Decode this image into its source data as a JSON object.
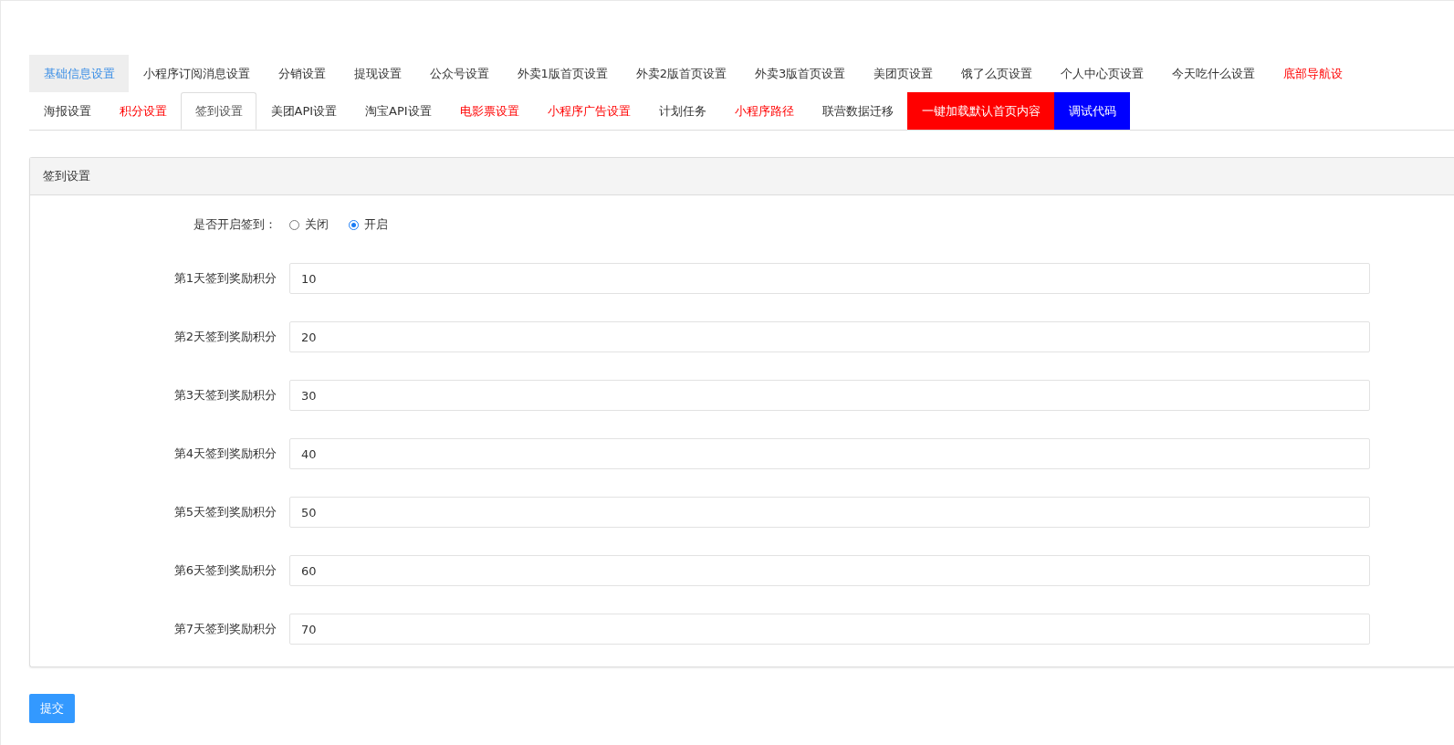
{
  "tab_rows": [
    [
      {
        "label": "基础信息设置",
        "kind": "highlight",
        "selected": false
      },
      {
        "label": "小程序订阅消息设置",
        "kind": "plain",
        "selected": false
      },
      {
        "label": "分销设置",
        "kind": "plain",
        "selected": false
      },
      {
        "label": "提现设置",
        "kind": "plain",
        "selected": false
      },
      {
        "label": "公众号设置",
        "kind": "plain",
        "selected": false
      },
      {
        "label": "外卖1版首页设置",
        "kind": "plain",
        "selected": false
      },
      {
        "label": "外卖2版首页设置",
        "kind": "plain",
        "selected": false
      },
      {
        "label": "外卖3版首页设置",
        "kind": "plain",
        "selected": false
      },
      {
        "label": "美团页设置",
        "kind": "plain",
        "selected": false
      },
      {
        "label": "饿了么页设置",
        "kind": "plain",
        "selected": false
      },
      {
        "label": "个人中心页设置",
        "kind": "plain",
        "selected": false
      },
      {
        "label": "今天吃什么设置",
        "kind": "plain",
        "selected": false
      },
      {
        "label": "底部导航设",
        "kind": "red",
        "selected": false
      }
    ],
    [
      {
        "label": "海报设置",
        "kind": "plain",
        "selected": false
      },
      {
        "label": "积分设置",
        "kind": "red",
        "selected": false
      },
      {
        "label": "签到设置",
        "kind": "plain",
        "selected": true
      },
      {
        "label": "美团API设置",
        "kind": "plain",
        "selected": false
      },
      {
        "label": "淘宝API设置",
        "kind": "plain",
        "selected": false
      },
      {
        "label": "电影票设置",
        "kind": "red",
        "selected": false
      },
      {
        "label": "小程序广告设置",
        "kind": "red",
        "selected": false
      },
      {
        "label": "计划任务",
        "kind": "plain",
        "selected": false
      },
      {
        "label": "小程序路径",
        "kind": "red",
        "selected": false
      },
      {
        "label": "联营数据迁移",
        "kind": "plain",
        "selected": false
      },
      {
        "label": "一键加载默认首页内容",
        "kind": "red-block",
        "selected": false
      },
      {
        "label": "调试代码",
        "kind": "blue-block",
        "selected": false
      }
    ]
  ],
  "panel": {
    "title": "签到设置",
    "switch": {
      "label": "是否开启签到：",
      "options": [
        {
          "label": "关闭",
          "selected": false
        },
        {
          "label": "开启",
          "selected": true
        }
      ]
    },
    "fields": [
      {
        "label": "第1天签到奖励积分",
        "value": "10"
      },
      {
        "label": "第2天签到奖励积分",
        "value": "20"
      },
      {
        "label": "第3天签到奖励积分",
        "value": "30"
      },
      {
        "label": "第4天签到奖励积分",
        "value": "40"
      },
      {
        "label": "第5天签到奖励积分",
        "value": "50"
      },
      {
        "label": "第6天签到奖励积分",
        "value": "60"
      },
      {
        "label": "第7天签到奖励积分",
        "value": "70"
      }
    ]
  },
  "submit": "提交"
}
